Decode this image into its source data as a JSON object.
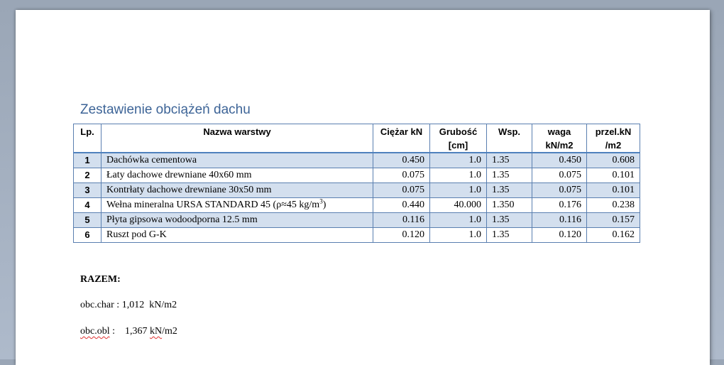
{
  "document": {
    "heading": "Zestawienie obciążeń dachu",
    "table": {
      "headers": {
        "lp": "Lp.",
        "name": "Nazwa warstwy",
        "weight": "Ciężar kN",
        "thickness_1": "Grubość",
        "thickness_2": "[cm]",
        "factor": "Wsp.",
        "waga_1": "waga",
        "waga_2": "kN/m2",
        "przel_1": "przel.kN",
        "przel_2": "/m2"
      },
      "rows": [
        {
          "lp": "1",
          "name": "Dachówka cementowa",
          "weight": "0.450",
          "thickness": "1.0",
          "factor": "1.35",
          "waga": "0.450",
          "przel": "0.608"
        },
        {
          "lp": "2",
          "name": "Łaty dachowe drewniane 40x60 mm",
          "weight": "0.075",
          "thickness": "1.0",
          "factor": "1.35",
          "waga": "0.075",
          "przel": "0.101"
        },
        {
          "lp": "3",
          "name": "Kontrłaty dachowe drewniane 30x50 mm",
          "weight": "0.075",
          "thickness": "1.0",
          "factor": "1.35",
          "waga": "0.075",
          "przel": "0.101"
        },
        {
          "lp": "4",
          "name": "Wełna mineralna URSA STANDARD 45 (ρ≈45 kg/m",
          "name_sup": "3",
          "name_end": ")",
          "weight": "0.440",
          "thickness": "40.000",
          "factor": "1.350",
          "waga": "0.176",
          "przel": "0.238"
        },
        {
          "lp": "5",
          "name": "Płyta gipsowa wodoodporna 12.5 mm",
          "weight": "0.116",
          "thickness": "1.0",
          "factor": "1.35",
          "waga": "0.116",
          "przel": "0.157"
        },
        {
          "lp": "6",
          "name": "Ruszt pod G-K",
          "weight": "0.120",
          "thickness": "1.0",
          "factor": "1.35",
          "waga": "0.120",
          "przel": "0.162"
        }
      ]
    },
    "summary": {
      "title": "RAZEM:",
      "char_label": "obc.char : ",
      "char_value": "1,012  kN/m2",
      "obl_label": "obc.obl",
      "obl_sep": " :    1,367 ",
      "obl_unit_a": "kN",
      "obl_unit_b": "/m2"
    }
  }
}
